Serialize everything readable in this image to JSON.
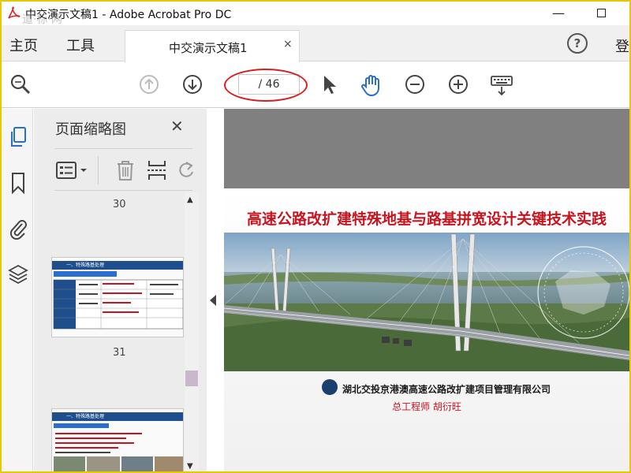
{
  "window": {
    "title": "中交演示文稿1 - Adobe Acrobat Pro DC",
    "watermark": "道·标·网"
  },
  "menubar": {
    "home_label": "主页",
    "tools_label": "工具",
    "tab_label": "中交演示文稿1",
    "tab_close": "×",
    "help_glyph": "?",
    "login_label": "登"
  },
  "toolbar": {
    "page_field_text": "/ 46",
    "total_pages": 46
  },
  "thumbnails": {
    "header": "页面缩略图",
    "close_glyph": "✕",
    "pages": [
      {
        "label": "30"
      },
      {
        "label": "31"
      }
    ],
    "thumb1_header": "一、特殊路基处理",
    "thumb2_header": "一、特殊路基处理"
  },
  "slide": {
    "title": "高速公路改扩建特殊地基与路基拼宽设计关键技术实践",
    "organization": "湖北交投京港澳高速公路改扩建项目管理有限公司",
    "author": "总工程师 胡衍旺"
  },
  "colors": {
    "accent_red": "#c8141e",
    "icon_gray": "#555555",
    "icon_blue": "#2a6fcf",
    "window_border": "#e8c800"
  },
  "icons": {
    "app": "acrobat-icon",
    "zoom": "zoom-search-icon",
    "prev": "arrow-up-circle-icon",
    "next": "arrow-down-circle-icon",
    "select": "pointer-arrow-icon",
    "hand": "hand-tool-icon",
    "zoom_out": "minus-circle-icon",
    "zoom_in": "plus-circle-icon",
    "keyboard": "keyboard-icon"
  }
}
